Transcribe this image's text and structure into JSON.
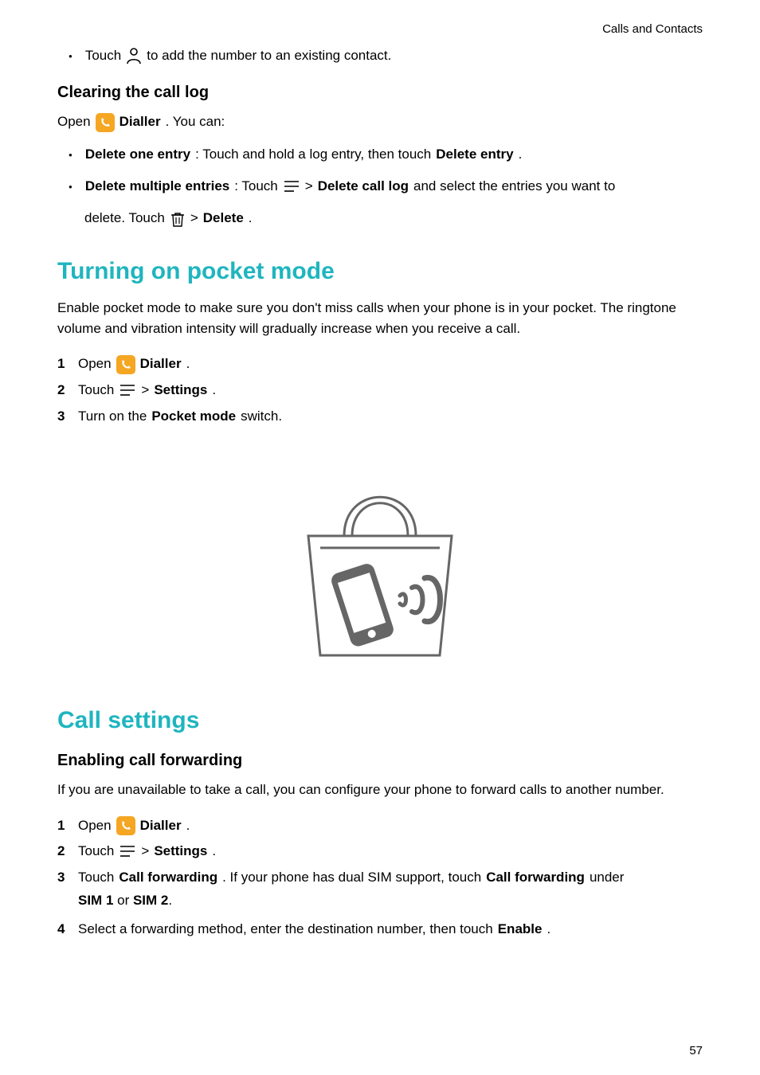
{
  "header": {
    "section": "Calls and Contacts"
  },
  "footer": {
    "page": "57"
  },
  "line_touch_add": {
    "pre": "Touch ",
    "post": " to add the number to an existing contact."
  },
  "clearing": {
    "heading": "Clearing the call log",
    "open": "Open ",
    "dialler": "Dialler",
    "youcan": ". You can:",
    "delete_one_label": "Delete one entry",
    "delete_one_rest": ": Touch and hold a log entry, then touch ",
    "delete_entry": "Delete entry",
    "period": ".",
    "delete_multi_label": "Delete multiple entries",
    "delete_multi_rest1": ": Touch ",
    "delete_multi_rest2": " > ",
    "delete_call_log": "Delete call log",
    "delete_multi_rest3": " and select the entries you want to",
    "delete_multi_line2a": "delete. Touch ",
    "delete_multi_line2b": " > ",
    "delete": "Delete",
    "delete_multi_line2c": "."
  },
  "pocket": {
    "heading": "Turning on pocket mode",
    "intro": "Enable pocket mode to make sure you don't miss calls when your phone is in your pocket. The ringtone volume and vibration intensity will gradually increase when you receive a call.",
    "step1_open": "Open ",
    "dialler": "Dialler",
    "period": ".",
    "step2_touch": "Touch ",
    "gt": " > ",
    "settings": "Settings",
    "step3_a": "Turn on the ",
    "pocket_mode": "Pocket mode",
    "step3_b": " switch."
  },
  "callsettings": {
    "heading": "Call settings",
    "sub": "Enabling call forwarding",
    "intro": "If you are unavailable to take a call, you can configure your phone to forward calls to another number.",
    "step1_open": "Open ",
    "dialler": "Dialler",
    "period": ".",
    "step2_touch": "Touch ",
    "gt": " > ",
    "settings": "Settings",
    "step3_a": "Touch ",
    "call_fwd": "Call forwarding",
    "step3_b": ". If your phone has dual SIM support, touch ",
    "step3_c": " under",
    "step3_line2a": "",
    "sim1": "SIM 1",
    "or": " or ",
    "sim2": "SIM 2",
    "step4_a": "Select a forwarding method, enter the destination number, then touch ",
    "enable": "Enable"
  },
  "nums": {
    "n1": "1",
    "n2": "2",
    "n3": "3",
    "n4": "4"
  }
}
